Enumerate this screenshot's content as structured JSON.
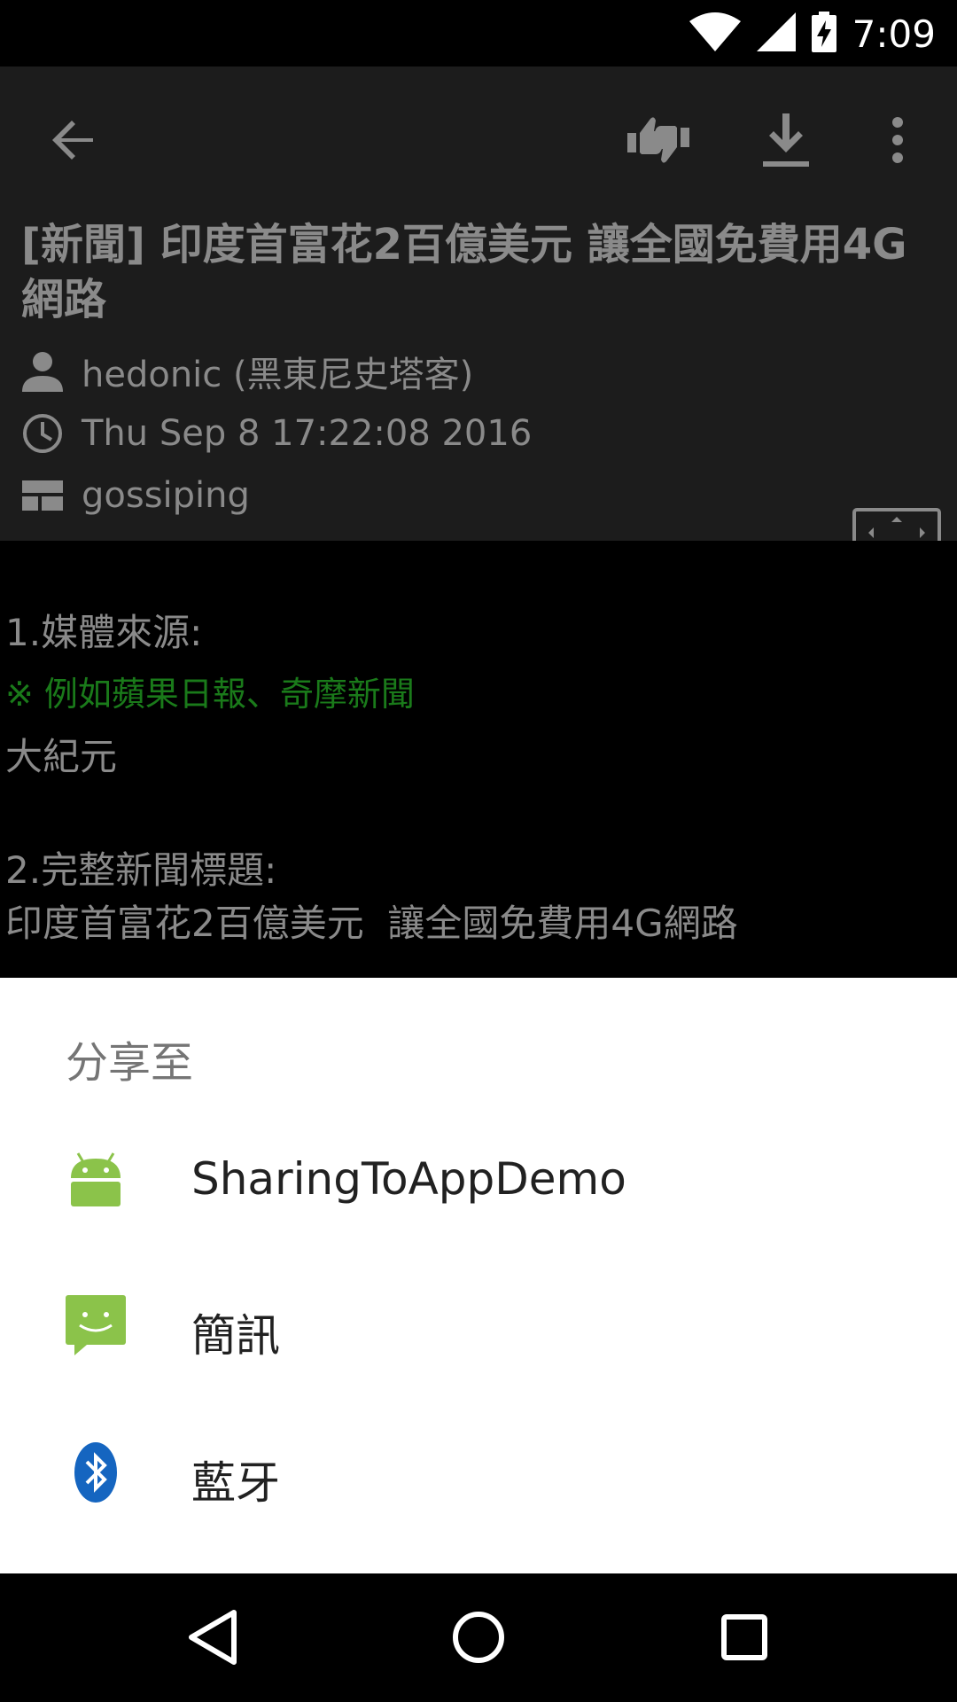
{
  "status": {
    "time": "7:09"
  },
  "article": {
    "title": "[新聞] 印度首富花2百億美元 讓全國免費用4G網路",
    "author": "hedonic (黑東尼史塔客)",
    "date": "Thu Sep  8 17:22:08 2016",
    "board": "gossiping",
    "body": [
      "1.媒體來源:",
      "※ 例如蘋果日報、奇摩新聞",
      "大紀元",
      "",
      "2.完整新聞標題:",
      "印度首富花2百億美元  讓全國免費用4G網路"
    ]
  },
  "share": {
    "title": "分享至",
    "items": [
      {
        "label": "SharingToAppDemo",
        "icon": "android-icon"
      },
      {
        "label": "簡訊",
        "icon": "messaging-icon"
      },
      {
        "label": "藍牙",
        "icon": "bluetooth-icon"
      }
    ]
  },
  "colors": {
    "appbar": "#1c1c1c",
    "muted_text": "#8a8a8a",
    "green_note": "#1a7a1a",
    "sheet_bg": "#ffffff",
    "android_green": "#8bc34a"
  }
}
